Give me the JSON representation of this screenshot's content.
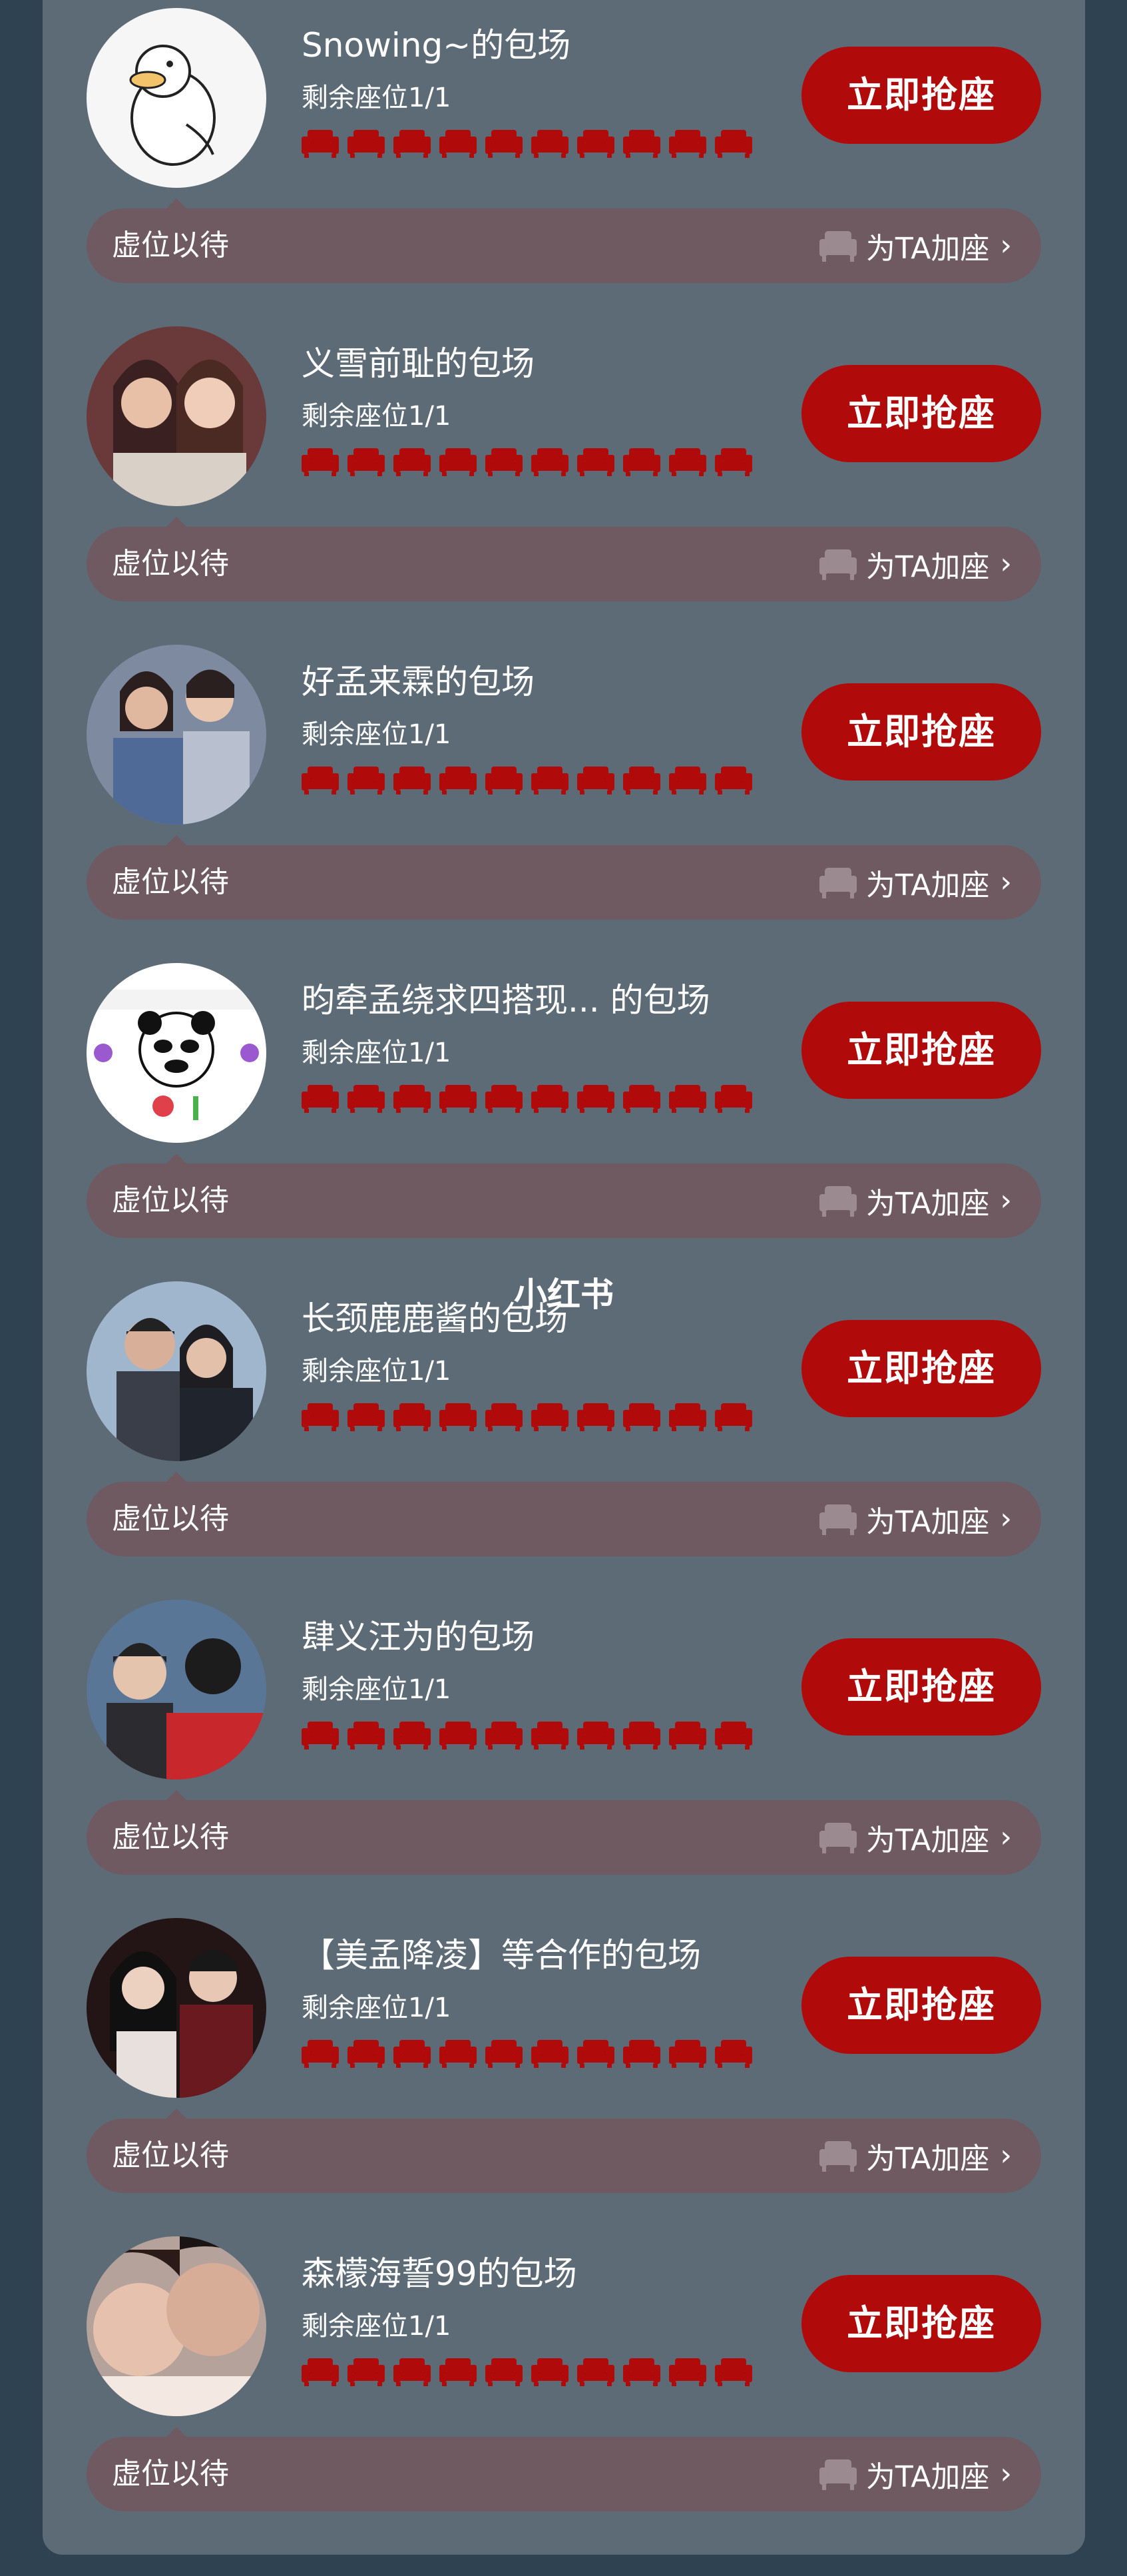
{
  "labels": {
    "grab_seat": "立即抢座",
    "waiting": "虚位以待",
    "add_seat": "为TA加座",
    "chevron": "›"
  },
  "watermark": "小红书",
  "seat_color": "#b00a0a",
  "seats_per_row": 10,
  "rooms": [
    {
      "name": "Snowing~的包场",
      "remaining": "剩余座位1/1"
    },
    {
      "name": "义雪前耻的包场",
      "remaining": "剩余座位1/1"
    },
    {
      "name": "好孟来霖的包场",
      "remaining": "剩余座位1/1"
    },
    {
      "name": "昀牵孟绕求四搭现... 的包场",
      "remaining": "剩余座位1/1"
    },
    {
      "name": "长颈鹿鹿酱的包场",
      "remaining": "剩余座位1/1"
    },
    {
      "name": "肆义汪为的包场",
      "remaining": "剩余座位1/1"
    },
    {
      "name": "【美孟降凌】等合作的包场",
      "remaining": "剩余座位1/1"
    },
    {
      "name": "森檬海誓99的包场",
      "remaining": "剩余座位1/1"
    }
  ]
}
